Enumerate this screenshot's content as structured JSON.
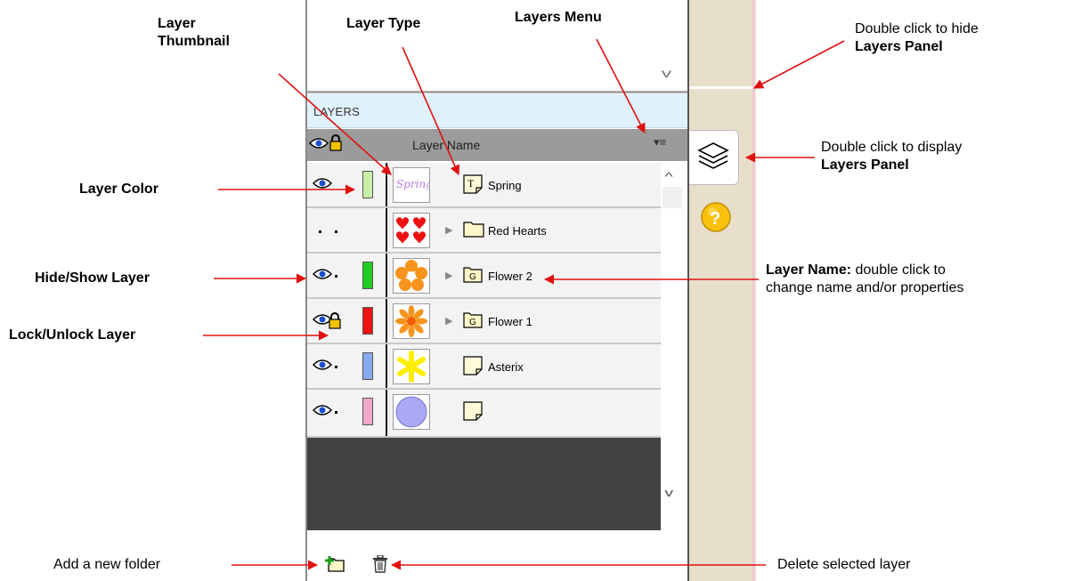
{
  "panel": {
    "header_label": "LAYERS",
    "column_name_label": "Layer Name",
    "menu_icon": "≡",
    "rows": [
      {
        "name": "Spring",
        "color": "#c8f0a8",
        "visible": true,
        "locked": false,
        "expandable": false,
        "type_icon": "text-layer-icon"
      },
      {
        "name": "Red Hearts",
        "color": null,
        "visible": false,
        "locked": false,
        "expandable": true,
        "type_icon": "folder-icon"
      },
      {
        "name": "Flower 2",
        "color": "#22cc22",
        "visible": true,
        "locked": false,
        "expandable": true,
        "type_icon": "group-icon"
      },
      {
        "name": "Flower 1",
        "color": "#ee1111",
        "visible": true,
        "locked": true,
        "expandable": true,
        "type_icon": "group-icon"
      },
      {
        "name": "Asterix",
        "color": "#88aaee",
        "visible": true,
        "locked": false,
        "expandable": false,
        "type_icon": "shape-layer-icon"
      },
      {
        "name": "",
        "color": "#f0a8cc",
        "visible": true,
        "locked": false,
        "expandable": false,
        "type_icon": "shape-layer-icon"
      }
    ],
    "thumb_spring_text": "Spring",
    "group_letter": "G",
    "text_letter": "T"
  },
  "annotations": {
    "layer_thumbnail": "Layer\nThumbnail",
    "layer_type": "Layer Type",
    "layers_menu": "Layers Menu",
    "hide_panel_line1": "Double click to hide",
    "hide_panel_line2": "Layers Panel",
    "display_panel_line1": "Double click to display",
    "display_panel_line2": "Layers Panel",
    "layer_color": "Layer Color",
    "hide_show_layer": "Hide/Show Layer",
    "lock_unlock_layer": "Lock/Unlock Layer",
    "layer_name_bold": "Layer Name:",
    "layer_name_rest1": " double click to",
    "layer_name_rest2": "change name and/or properties",
    "add_folder": "Add a new folder",
    "delete_layer": "Delete selected layer"
  },
  "colors": {
    "arrow": "#e01010",
    "header_bg": "#dff1fb",
    "column_bg": "#9b9b9b",
    "sidebar_bg": "#e8dfcb"
  }
}
